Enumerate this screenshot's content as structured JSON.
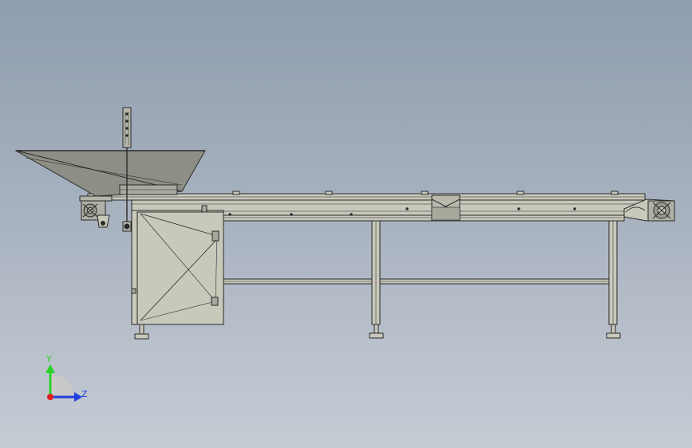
{
  "triad": {
    "y_label": "Y",
    "z_label": "Z",
    "y_color": "#2bd12b",
    "z_color": "#1f3fe0",
    "x_color": "#e02020",
    "quadrant_color": "#c9c9c9"
  },
  "model": {
    "body_color": "#c8c8bb",
    "hopper_color": "#8e8e86",
    "line_color": "#2a2a2a"
  }
}
